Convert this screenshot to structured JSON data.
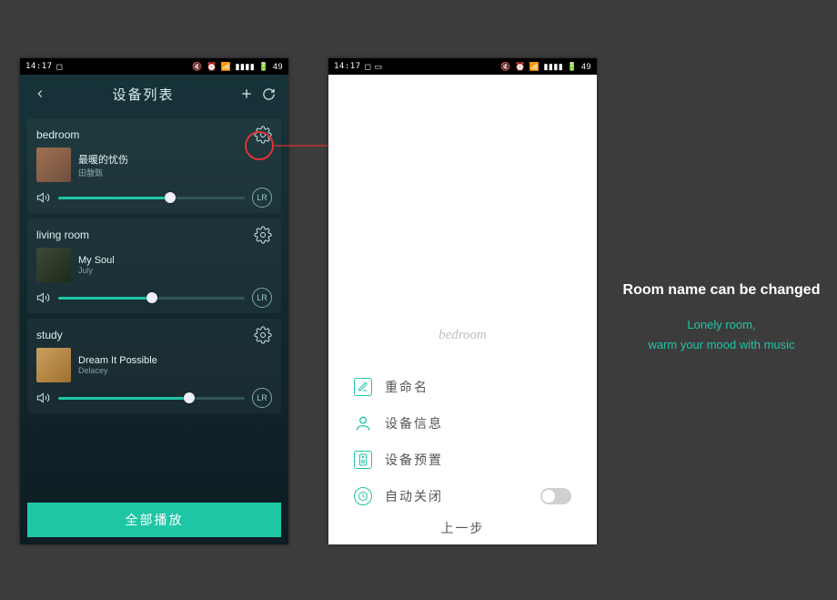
{
  "statusbar": {
    "time": "14:17",
    "battery": "49"
  },
  "leftPhone": {
    "header": {
      "title": "设备列表"
    },
    "devices": [
      {
        "name": "bedroom",
        "song": "最暖的忧伤",
        "artist": "田馥甄",
        "volume": 60
      },
      {
        "name": "living room",
        "song": "My Soul",
        "artist": "July",
        "volume": 50
      },
      {
        "name": "study",
        "song": "Dream It Possible",
        "artist": "Delacey",
        "volume": 70
      }
    ],
    "playAll": "全部播放"
  },
  "rightPhone": {
    "roomName": "bedroom",
    "menu": {
      "rename": "重命名",
      "info": "设备信息",
      "preset": "设备预置",
      "autoOff": "自动关闭"
    },
    "back": "上一步"
  },
  "caption": {
    "heading": "Room name can be changed",
    "line1": "Lonely room,",
    "line2": "warm your mood with music"
  }
}
